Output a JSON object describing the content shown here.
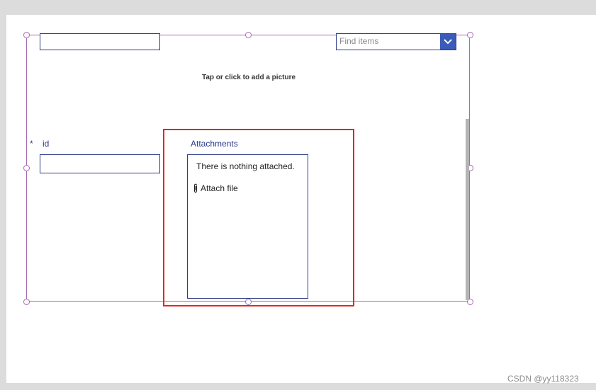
{
  "form": {
    "dropdown": {
      "placeholder": "Find items",
      "icon": "chevron-down-icon"
    },
    "picture": {
      "prompt": "Tap or click to add a picture"
    },
    "id_field": {
      "required_marker": "*",
      "label": "id",
      "value": ""
    },
    "attachments": {
      "label": "Attachments",
      "empty_message": "There is nothing attached.",
      "attach_label": "Attach file",
      "attach_icon": "paperclip-icon"
    }
  },
  "watermark": "CSDN @yy118323",
  "colors": {
    "selection": "#a46ab3",
    "control_border": "#2b3a8a",
    "dropdown_button": "#3a5bb8",
    "highlight": "#e82323",
    "canvas": "#ffffff",
    "backdrop": "#dcdcdc"
  }
}
